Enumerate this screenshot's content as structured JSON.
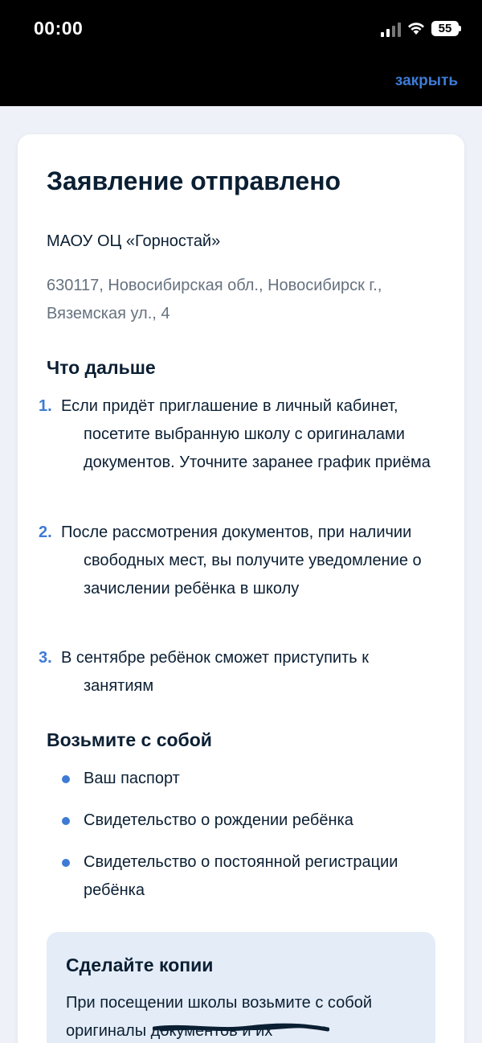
{
  "status_bar": {
    "time": "00:00",
    "battery": "55",
    "icons": [
      "signal-icon",
      "wifi-icon",
      "battery-icon"
    ]
  },
  "header": {
    "close_label": "закрыть"
  },
  "colors": {
    "accent": "#3e7bd5",
    "text": "#0b1f33",
    "muted": "#66727f",
    "panel": "#e4ecf7"
  },
  "card": {
    "title": "Заявление отправлено",
    "school_name": "МАОУ ОЦ «Горностай»",
    "address": "630117, Новосибирская обл., Новосибирск г., Вяземская ул., 4",
    "next_steps": {
      "title": "Что дальше",
      "items": [
        {
          "num": "1.",
          "text": "Если придёт приглашение в личный кабинет, посетите выбранную школу с оригиналами документов. Уточните заранее график приёма"
        },
        {
          "num": "2.",
          "text": "После рассмотрения документов, при наличии свободных мест, вы получите уведомление о зачислении ребёнка в школу"
        },
        {
          "num": "3.",
          "text": "В сентябре ребёнок сможет приступить к занятиям"
        }
      ]
    },
    "bring": {
      "title": "Возьмите с собой",
      "items": [
        "Ваш паспорт",
        "Свидетельство о рождении ребёнка",
        "Свидетельство о постоянной регистрации ребёнка"
      ]
    },
    "copies": {
      "title": "Сделайте копии",
      "text": "При посещении школы возьмите с собой оригиналы документов и их"
    }
  }
}
